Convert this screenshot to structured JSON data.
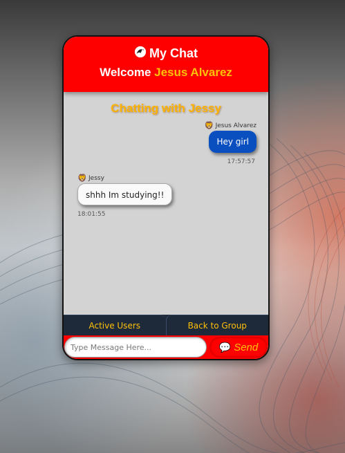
{
  "app": {
    "title": "My Chat",
    "welcome_prefix": "Welcome ",
    "username": "Jesus Alvarez",
    "logo_icon": "dolphin-icon"
  },
  "chat": {
    "heading": "Chatting with Jessy",
    "messages": [
      {
        "sender": "Jesus Alvarez",
        "avatar_icon": "lion-icon",
        "text": "Hey girl",
        "time": "17:57:57",
        "direction": "sent"
      },
      {
        "sender": "Jessy",
        "avatar_icon": "lion-icon",
        "text": "shhh Im studying!!",
        "time": "18:01:55",
        "direction": "received"
      }
    ]
  },
  "tabs": {
    "active_users": "Active Users",
    "back_to_group": "Back to Group"
  },
  "composer": {
    "placeholder": "Type Message Here...",
    "send_label": "Send",
    "send_icon": "speech-bubble-icon"
  },
  "colors": {
    "header_bg": "#ff0000",
    "accent": "#ffc107",
    "sent_bubble": "#0a4fbf",
    "chat_bg": "#d3d3d3"
  }
}
